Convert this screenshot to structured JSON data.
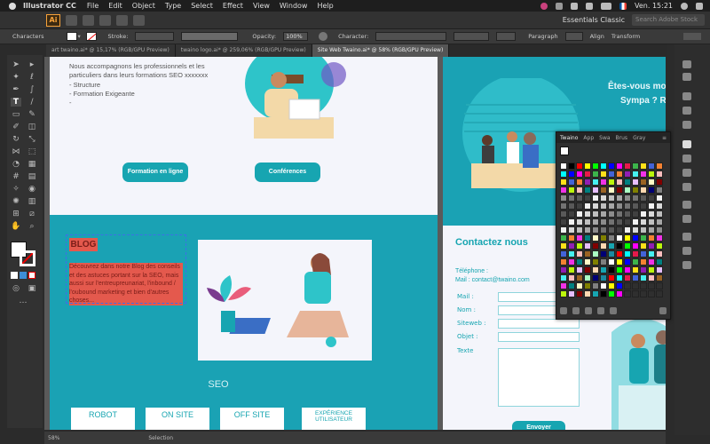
{
  "menubar": {
    "app_name": "Illustrator CC",
    "items": [
      "File",
      "Edit",
      "Object",
      "Type",
      "Select",
      "Effect",
      "View",
      "Window",
      "Help"
    ],
    "time": "Ven. 15:21"
  },
  "appbar": {
    "logo": "Ai",
    "workspace": "Essentials Classic",
    "search_placeholder": "Search Adobe Stock"
  },
  "control": {
    "characters": "Characters",
    "stroke": "Stroke:",
    "opacity_label": "Opacity:",
    "opacity": "100%",
    "character": "Character:",
    "paragraph": "Paragraph",
    "align": "Align",
    "transform": "Transform"
  },
  "tabs": [
    "art twaino.ai* @ 15,17% (RGB/GPU Preview)",
    "twaino logo.ai* @ 259,06% (RGB/GPU Preview)",
    "Site Web Twaino.ai* @ 58% (RGB/GPU Preview)"
  ],
  "left_art": {
    "intro": "Nous accompagnons les professionnels et les particuliers dans leurs formations SEO xxxxxxx",
    "bullets": [
      "- Structure",
      "- Formation Exigeante",
      "-"
    ],
    "btn_formation": "Formation en ligne",
    "btn_conferences": "Conférences",
    "blog_title": "BLOG",
    "blog_text": "Découvrez dans notre Blog des conseils et des astuces portant sur la SEO, mais aussi sur l'entreupreunariat, l'inbound / l'oubound marketing et bien d'autres choses...",
    "seo": "SEO",
    "services": [
      "ROBOT",
      "ON SITE",
      "OFF SITE",
      "EXPÉRIENCE UTILISATEUR"
    ]
  },
  "right_art": {
    "headline1": "Êtes-vous motivé ? A",
    "headline2": "Sympa ? Rejoigne",
    "contact_title": "Contactez nous",
    "phone": "Téléphone :",
    "mail": "Mail : contact@twaino.com",
    "form_labels": [
      "Mail :",
      "Nom :",
      "Siteweb :",
      "Objet :",
      "Texte"
    ],
    "send": "Envoyer"
  },
  "swatches_panel": {
    "tabs": [
      "Twaino",
      "App",
      "Swa",
      "Brus",
      "Gray"
    ],
    "colors": [
      "#ffffff",
      "#000000",
      "#ff0000",
      "#ffff00",
      "#00ff00",
      "#00ffff",
      "#0000ff",
      "#ff00ff",
      "#e6194b",
      "#3cb44b",
      "#ffe119",
      "#4363d8",
      "#f58231",
      "#911eb4",
      "#46f0f0",
      "#f032e6",
      "#bcf60c",
      "#fabebe",
      "#008080",
      "#e6beff",
      "#9a6324",
      "#fffac8",
      "#800000",
      "#aaffc3",
      "#808000",
      "#ffd8b1",
      "#000075",
      "#808080",
      "#17a5b1",
      "#1b8aa0"
    ],
    "grays": [
      "#f2f2f2",
      "#d9d9d9",
      "#bfbfbf",
      "#a6a6a6",
      "#8c8c8c",
      "#737373",
      "#595959",
      "#404040"
    ]
  },
  "status": {
    "zoom": "58%",
    "selection": "Selection"
  }
}
